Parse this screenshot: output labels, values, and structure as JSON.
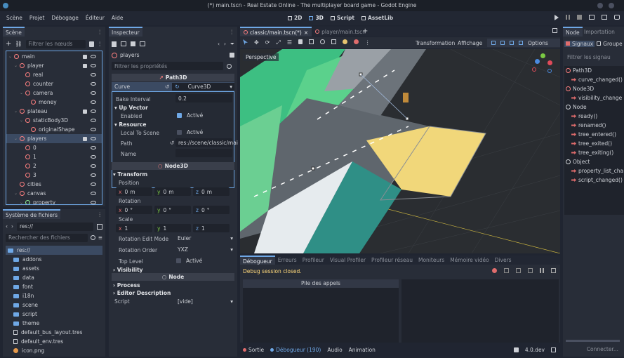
{
  "titlebar": {
    "title": "(*) main.tscn - Real Estate Online - The multiplayer board game - Godot Engine"
  },
  "menu": [
    "Scène",
    "Projet",
    "Débogage",
    "Éditeur",
    "Aide"
  ],
  "workspaces": [
    {
      "icon": "2d-icon",
      "label": "2D"
    },
    {
      "icon": "3d-icon",
      "label": "3D"
    },
    {
      "icon": "script-icon",
      "label": "Script"
    },
    {
      "icon": "assetlib-icon",
      "label": "AssetLib"
    }
  ],
  "scene_dock": {
    "tab": "Scène",
    "filter_placeholder": "Filtrer les nœuds",
    "nodes": [
      {
        "name": "main",
        "depth": 0,
        "color": "#fc7f7f",
        "sel": false
      },
      {
        "name": "player",
        "depth": 1,
        "color": "#fc7f7f",
        "sel": false
      },
      {
        "name": "real",
        "depth": 2,
        "color": "#fc7f7f",
        "sel": false
      },
      {
        "name": "counter",
        "depth": 2,
        "color": "#fc7f7f",
        "sel": false
      },
      {
        "name": "camera",
        "depth": 2,
        "color": "#fc7f7f",
        "sel": false
      },
      {
        "name": "money",
        "depth": 3,
        "color": "#fc7f7f",
        "sel": false
      },
      {
        "name": "plateau",
        "depth": 1,
        "color": "#fc7f7f",
        "sel": false
      },
      {
        "name": "staticBody3D",
        "depth": 2,
        "color": "#fc7f7f",
        "sel": false
      },
      {
        "name": "originalShape",
        "depth": 3,
        "color": "#fc7f7f",
        "sel": false
      },
      {
        "name": "players",
        "depth": 1,
        "color": "#fc7f7f",
        "sel": true
      },
      {
        "name": "0",
        "depth": 2,
        "color": "#fc7f7f",
        "sel": false
      },
      {
        "name": "1",
        "depth": 2,
        "color": "#fc7f7f",
        "sel": false
      },
      {
        "name": "2",
        "depth": 2,
        "color": "#fc7f7f",
        "sel": false
      },
      {
        "name": "3",
        "depth": 2,
        "color": "#fc7f7f",
        "sel": false
      },
      {
        "name": "cities",
        "depth": 1,
        "color": "#fc7f7f",
        "sel": false
      },
      {
        "name": "canvas",
        "depth": 1,
        "color": "#fc7f7f",
        "sel": false
      },
      {
        "name": "property",
        "depth": 2,
        "color": "#8eef97",
        "sel": false
      }
    ]
  },
  "fs_dock": {
    "title": "Système de fichiers",
    "path": "res://",
    "search_placeholder": "Rechercher des fichiers",
    "items": [
      {
        "name": "res://",
        "depth": 0,
        "kind": "folder",
        "sel": true
      },
      {
        "name": "addons",
        "depth": 1,
        "kind": "folder",
        "sel": false
      },
      {
        "name": "assets",
        "depth": 1,
        "kind": "folder",
        "sel": false
      },
      {
        "name": "data",
        "depth": 1,
        "kind": "folder",
        "sel": false
      },
      {
        "name": "font",
        "depth": 1,
        "kind": "folder",
        "sel": false
      },
      {
        "name": "i18n",
        "depth": 1,
        "kind": "folder",
        "sel": false
      },
      {
        "name": "scene",
        "depth": 1,
        "kind": "folder",
        "sel": false
      },
      {
        "name": "script",
        "depth": 1,
        "kind": "folder",
        "sel": false
      },
      {
        "name": "theme",
        "depth": 1,
        "kind": "folder",
        "sel": false
      },
      {
        "name": "default_bus_layout.tres",
        "depth": 1,
        "kind": "file",
        "sel": false
      },
      {
        "name": "default_env.tres",
        "depth": 1,
        "kind": "file",
        "sel": false
      },
      {
        "name": "icon.png",
        "depth": 1,
        "kind": "image",
        "sel": false
      }
    ]
  },
  "inspector": {
    "tab": "Inspecteur",
    "node": "players",
    "filter_placeholder": "Filtrer les propriétés",
    "path3d_header": "Path3D",
    "curve_label": "Curve",
    "curve_value": "Curve3D",
    "bake_label": "Bake Interval",
    "bake_value": "0.2",
    "up_vector": "Up Vector",
    "enabled_label": "Enabled",
    "enabled_value": "Activé",
    "resource": "Resource",
    "local_label": "Local To Scene",
    "local_value": "Activé",
    "path_label": "Path",
    "path_value": "res://scene/classic/mai",
    "name_label": "Name",
    "node3d_header": "Node3D",
    "transform": "Transform",
    "position_label": "Position",
    "pos": {
      "x": "0",
      "y": "0",
      "z": "0",
      "unit": "m"
    },
    "rotation_label": "Rotation",
    "rot": {
      "x": "0",
      "y": "0",
      "z": "0",
      "unit": "°"
    },
    "scale_label": "Scale",
    "scale": {
      "x": "1",
      "y": "1",
      "z": "1"
    },
    "rot_mode_label": "Rotation Edit Mode",
    "rot_mode_value": "Euler",
    "rot_order_label": "Rotation Order",
    "rot_order_value": "YXZ",
    "toplevel_label": "Top Level",
    "toplevel_value": "Activé",
    "visibility": "Visibility",
    "node_header": "Node",
    "process": "Process",
    "editor_desc": "Editor Description",
    "script_label": "Script",
    "script_value": "[vide]"
  },
  "editor_tabs": [
    {
      "label": "classic/main.tscn(*)",
      "active": true
    },
    {
      "label": "player/main.tscn",
      "active": false
    }
  ],
  "viewport": {
    "transform_menu": "Transformation",
    "view_menu": "Affichage",
    "options": "Options",
    "perspective": "Perspective"
  },
  "bottom": {
    "tabs": [
      "Débogueur",
      "Erreurs",
      "Profileur",
      "Visual Profiler",
      "Profileur réseau",
      "Moniteurs",
      "Mémoire vidéo",
      "Divers"
    ],
    "status": "Debug session closed.",
    "callstack": "Pile des appels"
  },
  "statusbar": {
    "output": "Sortie",
    "debugger": "Débogueur (190)",
    "audio": "Audio",
    "animation": "Animation",
    "version": "4.0.dev"
  },
  "node_dock": {
    "tab": "Node",
    "import_tab": "Importation",
    "signals": "Signaux",
    "groups": "Groupe",
    "filter_placeholder": "Filtrer les signau",
    "items": [
      {
        "text": "Path3D",
        "kind": "class"
      },
      {
        "text": "curve_changed()",
        "kind": "signal"
      },
      {
        "text": "Node3D",
        "kind": "class"
      },
      {
        "text": "visibility_change",
        "kind": "signal"
      },
      {
        "text": "Node",
        "kind": "class"
      },
      {
        "text": "ready()",
        "kind": "signal"
      },
      {
        "text": "renamed()",
        "kind": "signal"
      },
      {
        "text": "tree_entered()",
        "kind": "signal"
      },
      {
        "text": "tree_exited()",
        "kind": "signal"
      },
      {
        "text": "tree_exiting()",
        "kind": "signal"
      },
      {
        "text": "Object",
        "kind": "class"
      },
      {
        "text": "property_list_cha",
        "kind": "signal"
      },
      {
        "text": "script_changed()",
        "kind": "signal"
      }
    ],
    "connect": "Connecter..."
  },
  "colors": {
    "accent": "#6fa8e6",
    "node": "#fc7f7f",
    "control": "#8eef97",
    "error": "#fc7f7f",
    "warning": "#ffd87a"
  }
}
